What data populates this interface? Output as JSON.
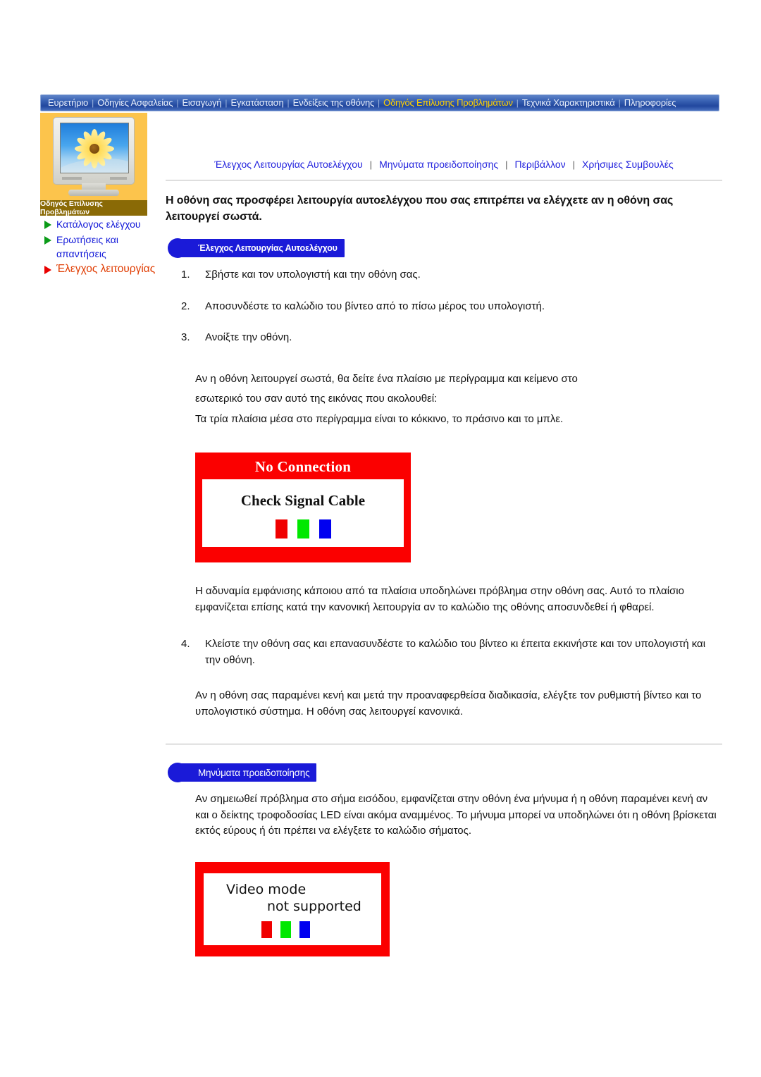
{
  "topnav": {
    "items": [
      {
        "label": "Ευρετήριο",
        "active": false
      },
      {
        "label": "Οδηγίες Ασφαλείας",
        "active": false
      },
      {
        "label": "Εισαγωγή",
        "active": false
      },
      {
        "label": "Εγκατάσταση",
        "active": false
      },
      {
        "label": "Ενδείξεις της οθόνης",
        "active": false
      },
      {
        "label": "Οδηγός Επίλυσης Προβλημάτων",
        "active": true
      },
      {
        "label": "Τεχνικά Χαρακτηριστικά",
        "active": false
      },
      {
        "label": "Πληροφορίες",
        "active": false
      }
    ],
    "separator": "|",
    "active_color": "#ffd000",
    "bar_color": "#21479e"
  },
  "sidebar": {
    "caption": "Οδηγός Επίλυσης Προβλημάτων",
    "panel_color": "#fcc44c",
    "caption_bg": "#8a6a06",
    "items": [
      {
        "label": "Κατάλογος ελέγχου",
        "current": false
      },
      {
        "label": "Ερωτήσεις και απαντήσεις",
        "current": false
      },
      {
        "label": "Έλεγχος λειτουργίας",
        "current": true
      }
    ],
    "link_color": "#1219d8",
    "current_color": "#e03b00"
  },
  "content": {
    "subnav": [
      "Έλεγχος Λειτουργίας Αυτοελέγχου",
      "Μηνύματα προειδοποίησης",
      "Περιβάλλον",
      "Χρήσιμες Συμβουλές"
    ],
    "subnav_separator": "|",
    "lead": "Η οθόνη σας προσφέρει λειτουργία αυτοελέγχου που σας επιτρέπει να ελέγχετε αν η οθόνη σας λειτουργεί σωστά.",
    "section1": {
      "badge": "Έλεγχος Λειτουργίας Αυτοελέγχου",
      "steps": [
        "Σβήστε και τον υπολογιστή και την οθόνη σας.",
        "Αποσυνδέστε το καλώδιο του βίντεο από το πίσω μέρος του υπολογιστή.",
        "Ανοίξτε την οθόνη."
      ],
      "para1_line1": "Αν η οθόνη λειτουργεί σωστά, θα δείτε ένα πλαίσιο με περίγραμμα και κείμενο στο",
      "para1_line2": "εσωτερικό του σαν αυτό της εικόνας που ακολουθεί:",
      "para1_line3": "Τα τρία πλαίσια μέσα στο περίγραμμα είναι το κόκκινο, το πράσινο και το μπλε.",
      "image1": {
        "title": "No Connection",
        "text": "Check Signal Cable",
        "swatches": [
          "#f00000",
          "#00e800",
          "#0000f0"
        ],
        "border_color": "#fb0000"
      },
      "para2": "Η αδυναμία εμφάνισης κάποιου από τα πλαίσια υποδηλώνει πρόβλημα στην οθόνη σας. Αυτό το πλαίσιο εμφανίζεται επίσης κατά την κανονική λειτουργία αν το καλώδιο της οθόνης αποσυνδεθεί ή φθαρεί.",
      "step4": "Κλείστε την οθόνη σας και επανασυνδέστε το καλώδιο του βίντεο κι έπειτα εκκινήστε και τον υπολογιστή και την οθόνη.",
      "para3": "Αν η οθόνη σας παραμένει κενή και μετά την προαναφερθείσα διαδικασία, ελέγξτε τον ρυθμιστή βίντεο και το υπολογιστικό σύστημα. Η οθόνη σας λειτουργεί κανονικά."
    },
    "section2": {
      "badge": "Μηνύματα προειδοποίησης",
      "para1": "Αν σημειωθεί πρόβλημα στο σήμα εισόδου, εμφανίζεται στην οθόνη ένα μήνυμα ή η οθόνη παραμένει κενή αν και ο δείκτης τροφοδοσίας LED είναι ακόμα αναμμένος. Το μήνυμα μπορεί να υποδηλώνει ότι η οθόνη βρίσκεται εκτός εύρους ή ότι πρέπει να ελέγξετε το καλώδιο σήματος.",
      "image2": {
        "line1": "Video mode",
        "line2": "not  supported",
        "swatches": [
          "#f00000",
          "#00e800",
          "#0000f0"
        ],
        "border_color": "#fb0000"
      }
    }
  }
}
